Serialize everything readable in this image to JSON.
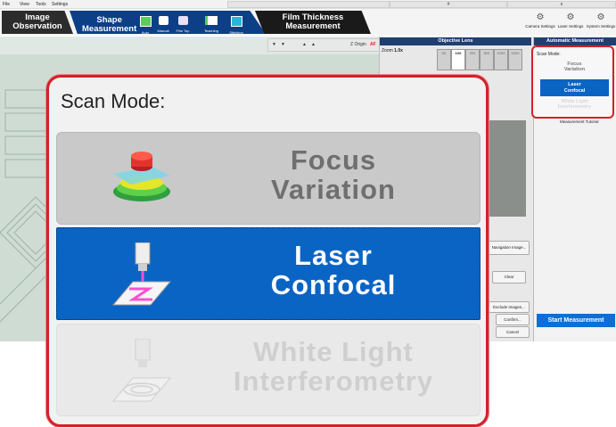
{
  "menu": {
    "items": [
      "File",
      "View",
      "Tools",
      "Settings"
    ],
    "cells": [
      "",
      "#",
      "x"
    ]
  },
  "ribbon": {
    "tabs": {
      "image": "Image\nObservation",
      "shape": "Shape\nMeasurement",
      "film": "Film Thickness\nMeasurement"
    },
    "tools": [
      "Auto",
      "Manual",
      "Film Top",
      "Teaching",
      "Stitching"
    ],
    "right_tools": [
      "Camera Settings",
      "Laser Settings",
      "System Settings"
    ]
  },
  "viewer_toolbar": {
    "z_origin": "Z Origin",
    "af": "AF"
  },
  "objective": {
    "title": "Objective Lens",
    "zoom_label": "Zoom",
    "zoom_value": "1.0x",
    "lenses": [
      "5X",
      "10X",
      "20X",
      "50X",
      "100X",
      "150X"
    ]
  },
  "left_panel": {
    "nav_button": "Navigation Image...",
    "clear": "Clear",
    "exclude": "Exclude Images...",
    "confirm": "Confirm...",
    "cancel": "Cancel"
  },
  "auto": {
    "title": "Automatic Measurement",
    "scan_mode_label": "Scan Mode:",
    "tutorial": "Measurement Tutorial",
    "start": "Start Measurement"
  },
  "scan_mode": {
    "title": "Scan Mode:",
    "options": [
      {
        "line1": "Focus",
        "line2": "Variation",
        "state": "available"
      },
      {
        "line1": "Laser",
        "line2": "Confocal",
        "state": "selected"
      },
      {
        "line1": "White Light",
        "line2": "Interferometry",
        "state": "disabled"
      }
    ]
  },
  "colors": {
    "accent": "#0a64c4",
    "highlight_border": "#d5202a",
    "tab_blue": "#0c3f86"
  }
}
